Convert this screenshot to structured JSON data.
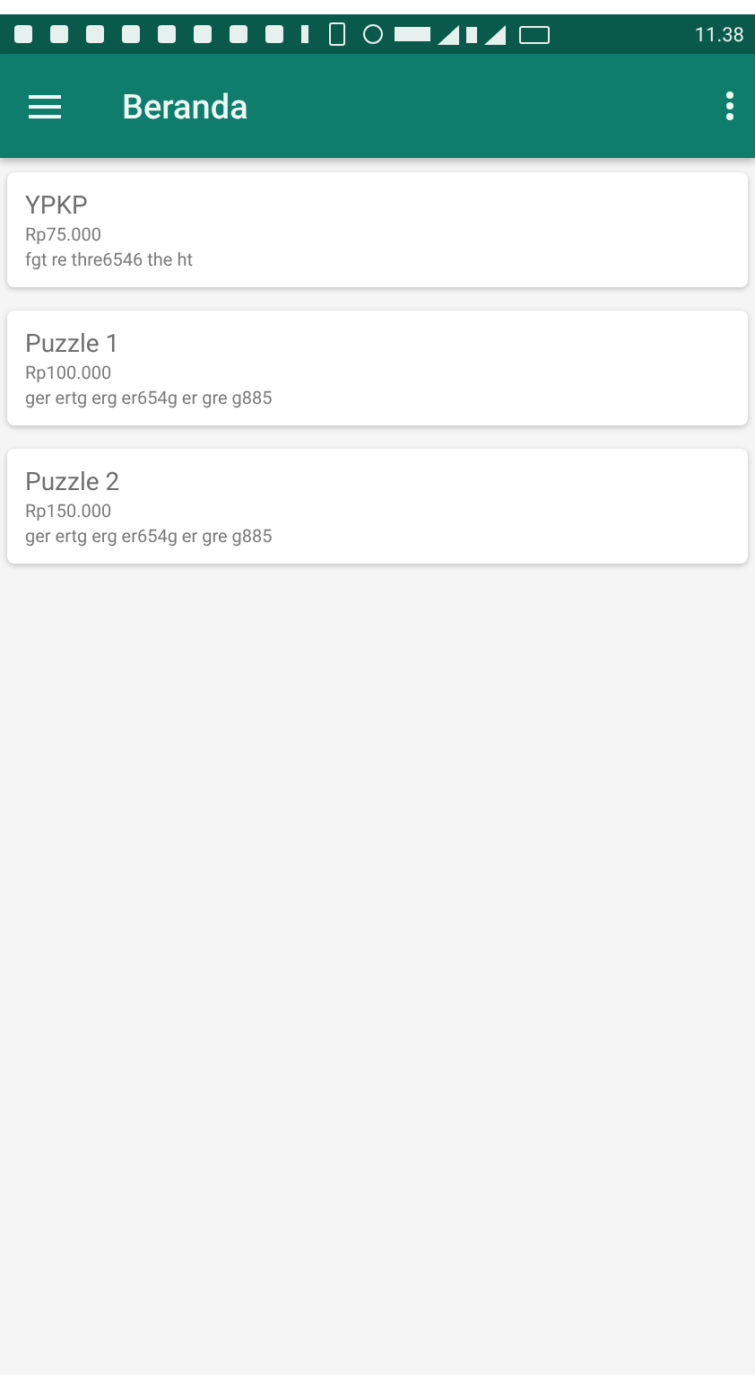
{
  "status_bar": {
    "time": "11.38"
  },
  "app_bar": {
    "title": "Beranda"
  },
  "products": [
    {
      "name": "YPKP",
      "price": "Rp75.000",
      "description": "fgt re thre6546 the ht"
    },
    {
      "name": "Puzzle 1",
      "price": "Rp100.000",
      "description": "ger ertg erg er654g er gre g885"
    },
    {
      "name": "Puzzle 2",
      "price": "Rp150.000",
      "description": "ger ertg erg er654g er gre g885"
    }
  ]
}
